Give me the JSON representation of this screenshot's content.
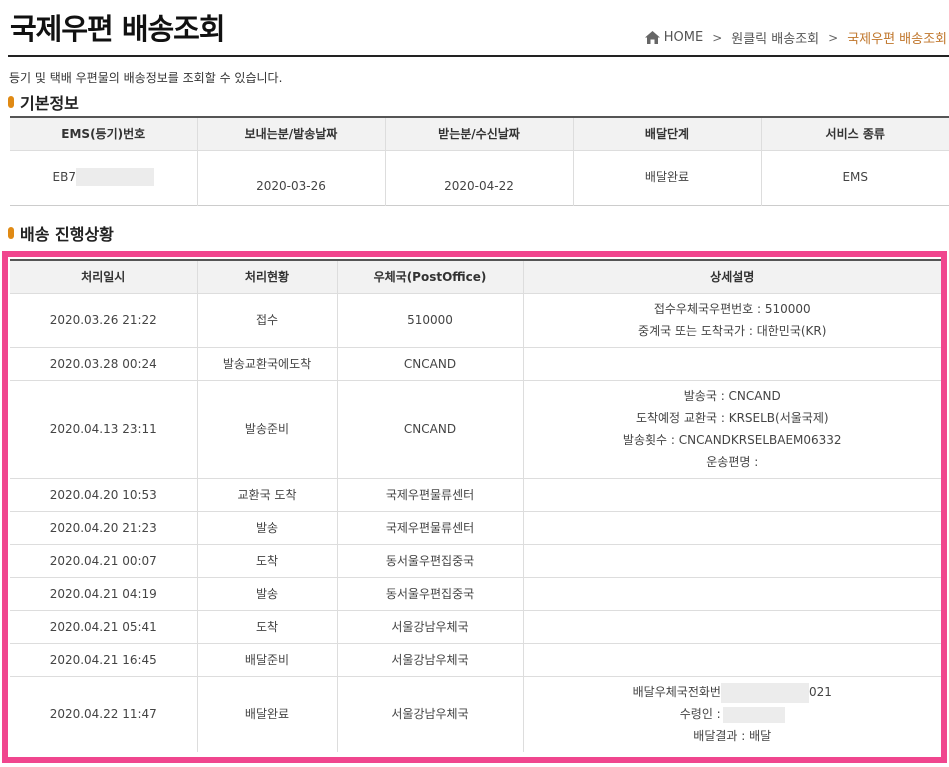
{
  "page": {
    "title": "국제우편 배송조회",
    "description": "등기 및 택배 우편물의 배송정보를 조회할 수 있습니다."
  },
  "breadcrumb": {
    "home": "HOME",
    "level1": "원클릭 배송조회",
    "current": "국제우편 배송조회"
  },
  "basic_info": {
    "section_title": "기본정보",
    "headers": [
      "EMS(등기)번호",
      "보내는분/발송날짜",
      "받는분/수신날짜",
      "배달단계",
      "서비스 종류"
    ],
    "ems_number": "EB7",
    "send_date": "2020-03-26",
    "receive_date": "2020-04-22",
    "delivery_stage": "배달완료",
    "service_type": "EMS"
  },
  "progress": {
    "section_title": "배송 진행상황",
    "headers": [
      "처리일시",
      "처리현황",
      "우체국(PostOffice)",
      "상세설명"
    ],
    "rows": [
      {
        "datetime": "2020.03.26 21:22",
        "status": "접수",
        "office": "510000",
        "detail1": "접수우체국우편번호 : 510000",
        "detail2": "중계국 또는 도착국가 : 대한민국(KR)"
      },
      {
        "datetime": "2020.03.28 00:24",
        "status": "발송교환국에도착",
        "office": "CNCAND"
      },
      {
        "datetime": "2020.04.13 23:11",
        "status": "발송준비",
        "office": "CNCAND",
        "detail1": "발송국 : CNCAND",
        "detail2": "도착예정 교환국 : KRSELB(서울국제)",
        "detail3": "발송횟수 : CNCANDKRSELBAEM06332",
        "detail4": "운송편명 :"
      },
      {
        "datetime": "2020.04.20 10:53",
        "status": "교환국 도착",
        "office": "국제우편물류센터"
      },
      {
        "datetime": "2020.04.20 21:23",
        "status": "발송",
        "office": "국제우편물류센터"
      },
      {
        "datetime": "2020.04.21 00:07",
        "status": "도착",
        "office": "동서울우편집중국"
      },
      {
        "datetime": "2020.04.21 04:19",
        "status": "발송",
        "office": "동서울우편집중국"
      },
      {
        "datetime": "2020.04.21 05:41",
        "status": "도착",
        "office": "서울강남우체국"
      },
      {
        "datetime": "2020.04.21 16:45",
        "status": "배달준비",
        "office": "서울강남우체국"
      },
      {
        "datetime": "2020.04.22 11:47",
        "status": "배달완료",
        "office": "서울강남우체국",
        "detail1a": "배달우체국전화번",
        "detail1b": "021",
        "detail2": "수령인 :",
        "detail3": "배달결과 : 배달"
      }
    ]
  },
  "colors": {
    "highlight": "#f0468e",
    "accent": "#c0762b",
    "bullet": "#e08a14"
  },
  "icons": {
    "home": "home-icon",
    "separator": "chevron-right-icon",
    "section_bullet": "section-bullet-icon"
  }
}
